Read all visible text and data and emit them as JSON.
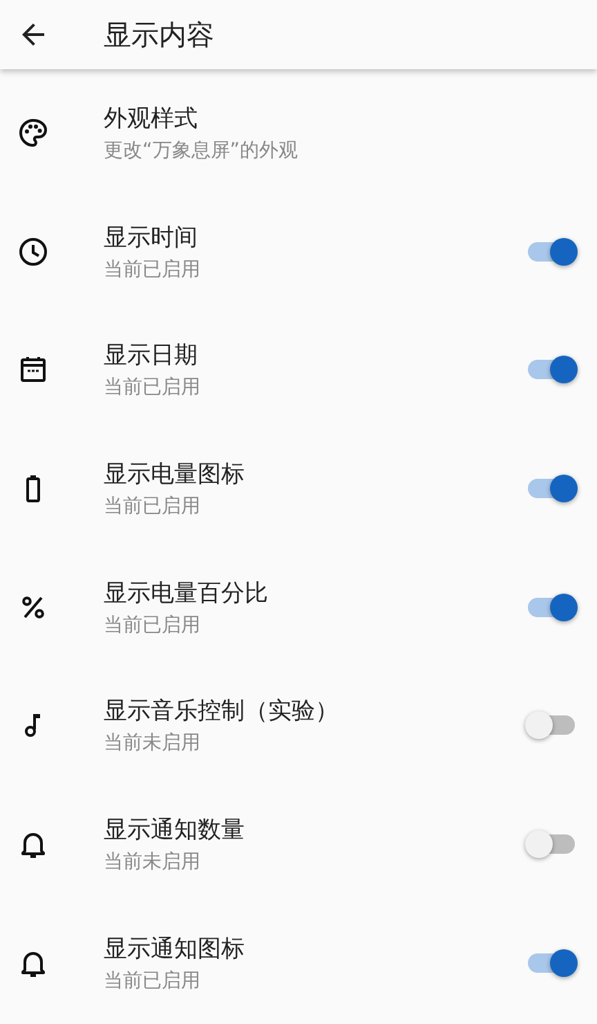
{
  "app_bar": {
    "title": "显示内容"
  },
  "items": [
    {
      "kind": "plain",
      "title": "外观样式",
      "subtitle": "更改“万象息屏”的外观"
    },
    {
      "kind": "toggle",
      "title": "显示时间",
      "subtitle": "当前已启用",
      "on": true
    },
    {
      "kind": "toggle",
      "title": "显示日期",
      "subtitle": "当前已启用",
      "on": true
    },
    {
      "kind": "toggle",
      "title": "显示电量图标",
      "subtitle": "当前已启用",
      "on": true
    },
    {
      "kind": "toggle",
      "title": "显示电量百分比",
      "subtitle": "当前已启用",
      "on": true
    },
    {
      "kind": "toggle",
      "title": "显示音乐控制（实验）",
      "subtitle": "当前未启用",
      "on": false
    },
    {
      "kind": "toggle",
      "title": "显示通知数量",
      "subtitle": "当前未启用",
      "on": false
    },
    {
      "kind": "toggle",
      "title": "显示通知图标",
      "subtitle": "当前已启用",
      "on": true
    }
  ]
}
